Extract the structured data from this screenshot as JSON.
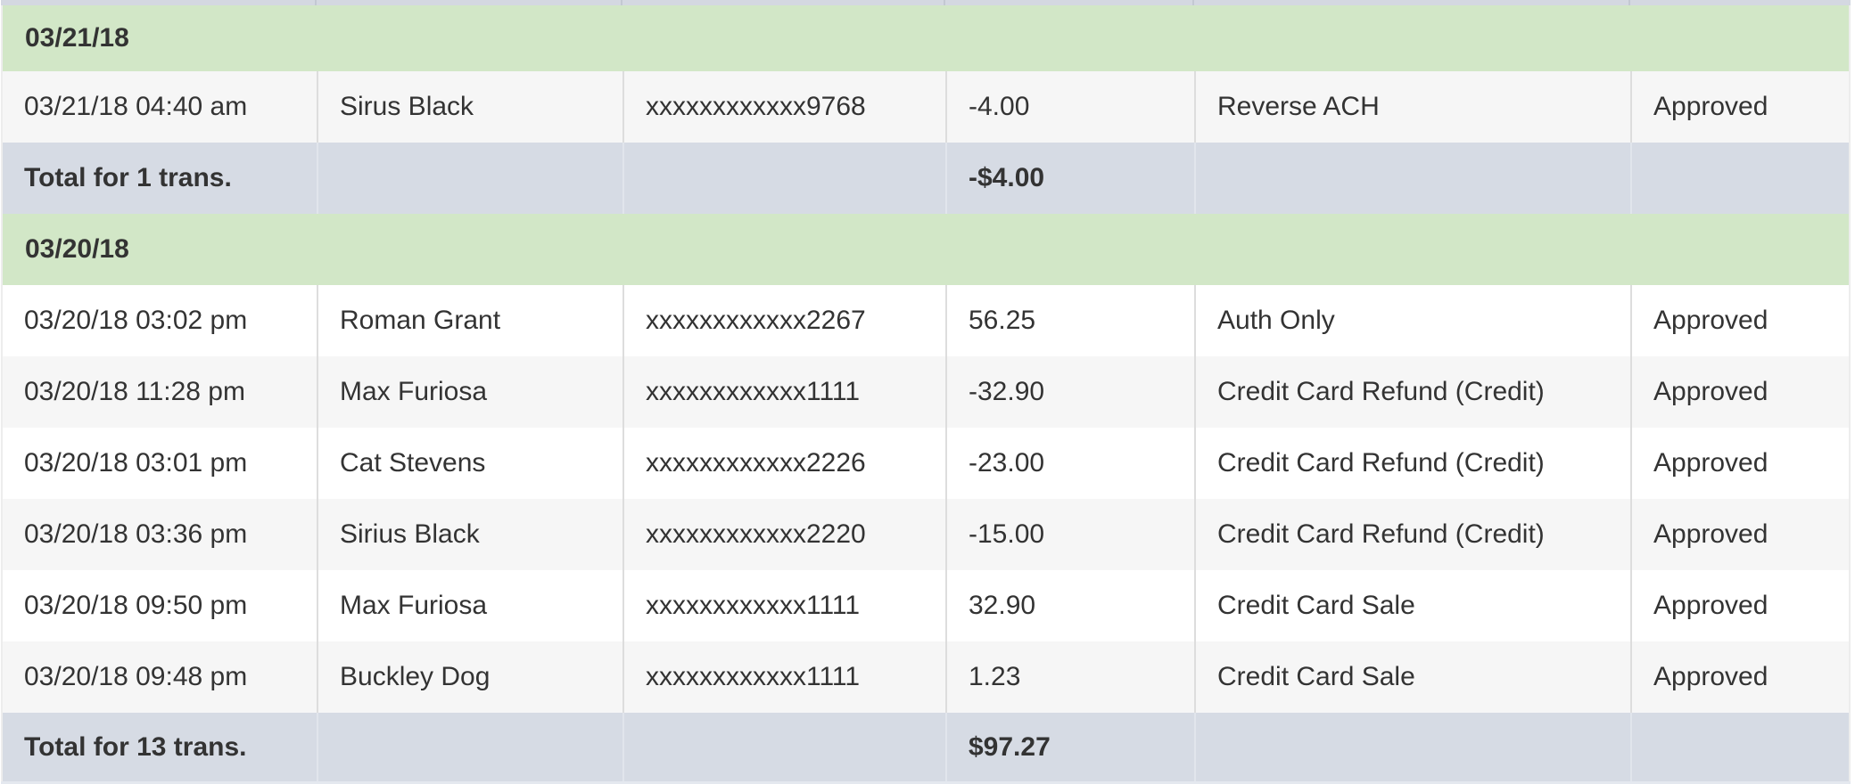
{
  "colors": {
    "group_header_bg": "#d2e7c7",
    "total_row_bg": "#d6dbe4",
    "stripe_row_bg": "#f6f6f6",
    "row_bg": "#ffffff",
    "text": "#333333",
    "cell_border": "#dddddd",
    "top_edge": "#d4d8e1"
  },
  "table": {
    "columns": [
      "datetime",
      "name",
      "card",
      "amount",
      "type",
      "status"
    ],
    "groups": [
      {
        "date": "03/21/18",
        "rows": [
          {
            "datetime": "03/21/18 04:40 am",
            "name": "Sirus Black",
            "card": "xxxxxxxxxxxx9768",
            "amount": "-4.00",
            "type": "Reverse ACH",
            "status": "Approved"
          }
        ],
        "total_label": "Total for 1 trans.",
        "total_amount": "-$4.00"
      },
      {
        "date": "03/20/18",
        "rows": [
          {
            "datetime": "03/20/18 03:02 pm",
            "name": "Roman Grant",
            "card": "xxxxxxxxxxxx2267",
            "amount": "56.25",
            "type": "Auth Only",
            "status": "Approved"
          },
          {
            "datetime": "03/20/18 11:28 pm",
            "name": "Max Furiosa",
            "card": "xxxxxxxxxxxx1111",
            "amount": "-32.90",
            "type": "Credit Card Refund (Credit)",
            "status": "Approved"
          },
          {
            "datetime": "03/20/18 03:01 pm",
            "name": "Cat Stevens",
            "card": "xxxxxxxxxxxx2226",
            "amount": "-23.00",
            "type": "Credit Card Refund (Credit)",
            "status": "Approved"
          },
          {
            "datetime": "03/20/18 03:36 pm",
            "name": "Sirius Black",
            "card": "xxxxxxxxxxxx2220",
            "amount": "-15.00",
            "type": "Credit Card Refund (Credit)",
            "status": "Approved"
          },
          {
            "datetime": "03/20/18 09:50 pm",
            "name": "Max Furiosa",
            "card": "xxxxxxxxxxxx1111",
            "amount": "32.90",
            "type": "Credit Card Sale",
            "status": "Approved"
          },
          {
            "datetime": "03/20/18 09:48 pm",
            "name": "Buckley Dog",
            "card": "xxxxxxxxxxxx1111",
            "amount": "1.23",
            "type": "Credit Card Sale",
            "status": "Approved"
          }
        ],
        "total_label": "Total for 13 trans.",
        "total_amount": "$97.27"
      }
    ]
  }
}
